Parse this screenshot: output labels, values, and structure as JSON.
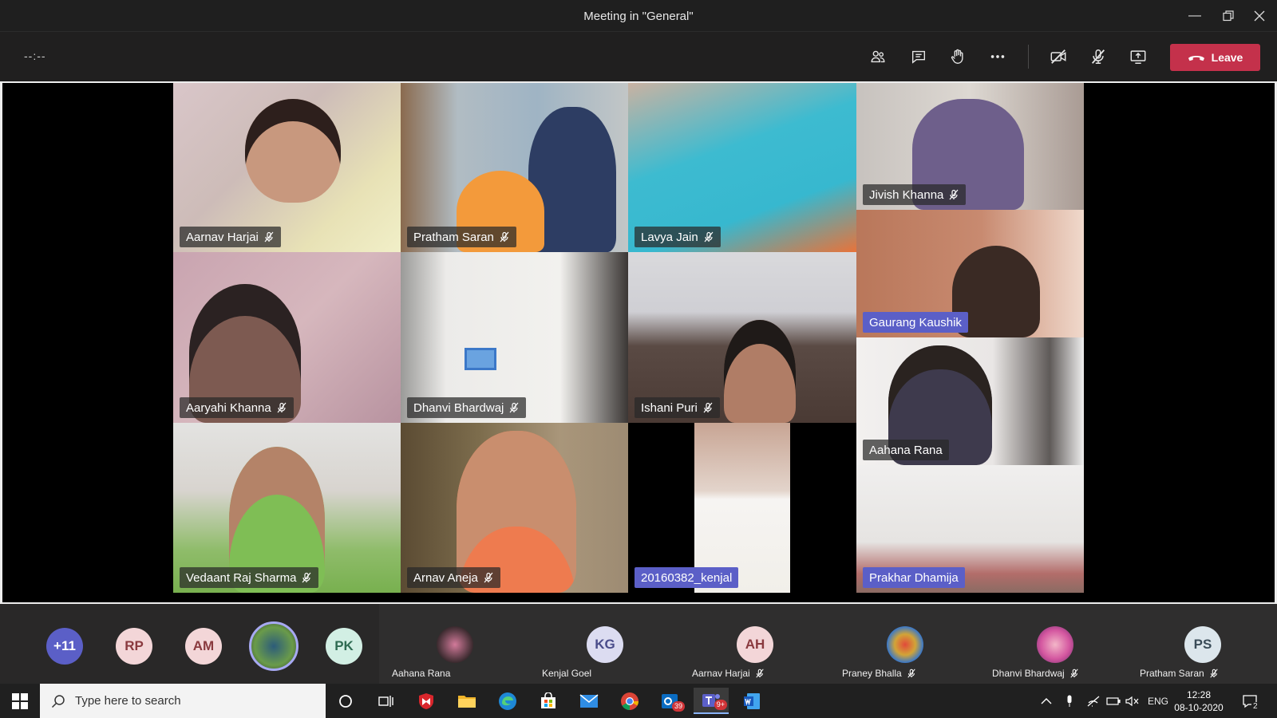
{
  "window": {
    "title": "Meeting in \"General\""
  },
  "toolbar": {
    "timer": "--:--",
    "leave_label": "Leave"
  },
  "tiles": [
    {
      "name": "Aarnav Harjai",
      "muted": true,
      "blue": false
    },
    {
      "name": "Pratham Saran",
      "muted": true,
      "blue": false
    },
    {
      "name": "Lavya Jain",
      "muted": true,
      "blue": false
    },
    {
      "name": "Jivish Khanna",
      "muted": true,
      "blue": false
    },
    {
      "name": "Gaurang Kaushik",
      "muted": false,
      "blue": true
    },
    {
      "name": "Aaryahi Khanna",
      "muted": true,
      "blue": false
    },
    {
      "name": "Dhanvi Bhardwaj",
      "muted": true,
      "blue": false
    },
    {
      "name": "Ishani Puri",
      "muted": true,
      "blue": false
    },
    {
      "name": "Aahana Rana",
      "muted": false,
      "blue": false
    },
    {
      "name": "Vedaant Raj Sharma",
      "muted": true,
      "blue": false
    },
    {
      "name": "Arnav Aneja",
      "muted": true,
      "blue": false
    },
    {
      "name": "20160382_kenjal",
      "muted": false,
      "blue": true
    },
    {
      "name": "Prakhar Dhamija",
      "muted": false,
      "blue": true
    }
  ],
  "strip": {
    "overflow": "+11",
    "initials": [
      "RP",
      "AM",
      "PK"
    ],
    "participants": [
      {
        "name": "Aahana Rana",
        "initials": "",
        "muted": false
      },
      {
        "name": "Kenjal Goel",
        "initials": "KG",
        "muted": false
      },
      {
        "name": "Aarnav Harjai",
        "initials": "AH",
        "muted": true
      },
      {
        "name": "Praney Bhalla",
        "initials": "",
        "muted": true
      },
      {
        "name": "Dhanvi Bhardwaj",
        "initials": "",
        "muted": true
      },
      {
        "name": "Pratham Saran",
        "initials": "PS",
        "muted": true
      }
    ]
  },
  "taskbar": {
    "search_placeholder": "Type here to search",
    "mail_badge": "39",
    "teams_badge": "9+",
    "lang": "ENG",
    "time": "12:28",
    "date": "08-10-2020",
    "notif_count": "2"
  },
  "colors": {
    "leave": "#c4314b",
    "accent": "#5b5fc7"
  }
}
